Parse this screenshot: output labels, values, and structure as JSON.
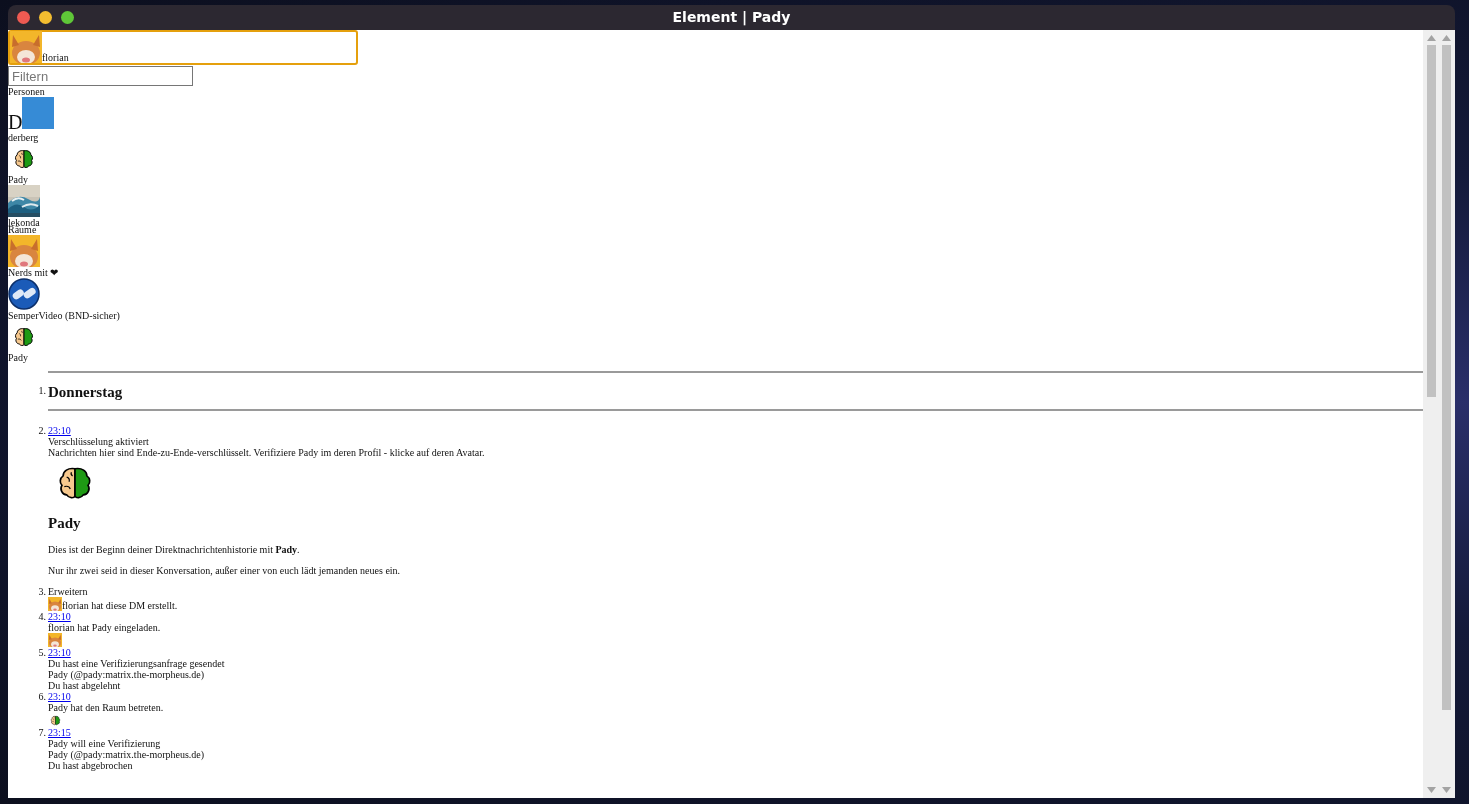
{
  "window": {
    "title": "Element | Pady"
  },
  "account": {
    "name": "florian",
    "avatar": {
      "kind": "picture"
    }
  },
  "filter": {
    "placeholder": "Filtern"
  },
  "sections": [
    {
      "title": "Personen",
      "rooms": [
        {
          "name": "derberg",
          "avatar": {
            "kind": "letter",
            "letter": "D"
          }
        },
        {
          "name": "Pady",
          "avatar": {
            "kind": "brain"
          }
        },
        {
          "name": "lekonda",
          "avatar": {
            "kind": "picture"
          }
        }
      ]
    },
    {
      "title": "Räume",
      "rooms": [
        {
          "name": "Nerds mit ❤",
          "avatar": {
            "kind": "picture"
          }
        },
        {
          "name": "SemperVideo (BND-sicher)",
          "avatar": {
            "kind": "logo"
          }
        },
        {
          "name": "Pady",
          "avatar": {
            "kind": "brain"
          }
        }
      ]
    }
  ],
  "timeline": [
    {
      "kind": "date",
      "marker": "1.",
      "label": "Donnerstag"
    },
    {
      "kind": "event",
      "marker": "2.",
      "time": "23:10",
      "lines": [
        "Verschlüsselung aktiviert",
        "Nachrichten hier sind Ende-zu-Ende-verschlüsselt. Verifiziere Pady im deren Profil - klicke auf deren Avatar."
      ],
      "intro": {
        "avatar": {
          "kind": "brain"
        },
        "heading": "Pady",
        "paragraphs": [
          "Dies ist der Beginn deiner Direktnachrichtenhistorie mit **Pady**.",
          "Nur ihr zwei seid in dieser Konversation, außer einer von euch lädt jemanden neues ein."
        ]
      }
    },
    {
      "kind": "summary",
      "marker": "3.",
      "label": "Erweitern",
      "avatar": {
        "kind": "picture"
      },
      "text": "florian hat diese DM erstellt."
    },
    {
      "kind": "event",
      "marker": "4.",
      "time": "23:10",
      "lines": [
        "florian hat Pady eingeladen."
      ],
      "receipt": {
        "kind": "picture"
      }
    },
    {
      "kind": "event",
      "marker": "5.",
      "time": "23:10",
      "lines": [
        "Du hast eine Verifizierungsanfrage gesendet",
        "Pady (@pady:matrix.the-morpheus.de)",
        "Du hast abgelehnt"
      ]
    },
    {
      "kind": "event",
      "marker": "6.",
      "time": "23:10",
      "lines": [
        "Pady hat den Raum betreten."
      ],
      "receipt": {
        "kind": "brain"
      }
    },
    {
      "kind": "event",
      "marker": "7.",
      "time": "23:15",
      "lines": [
        "Pady will eine Verifizierung",
        "Pady (@pady:matrix.the-morpheus.de)",
        "Du hast abgebrochen"
      ]
    }
  ]
}
